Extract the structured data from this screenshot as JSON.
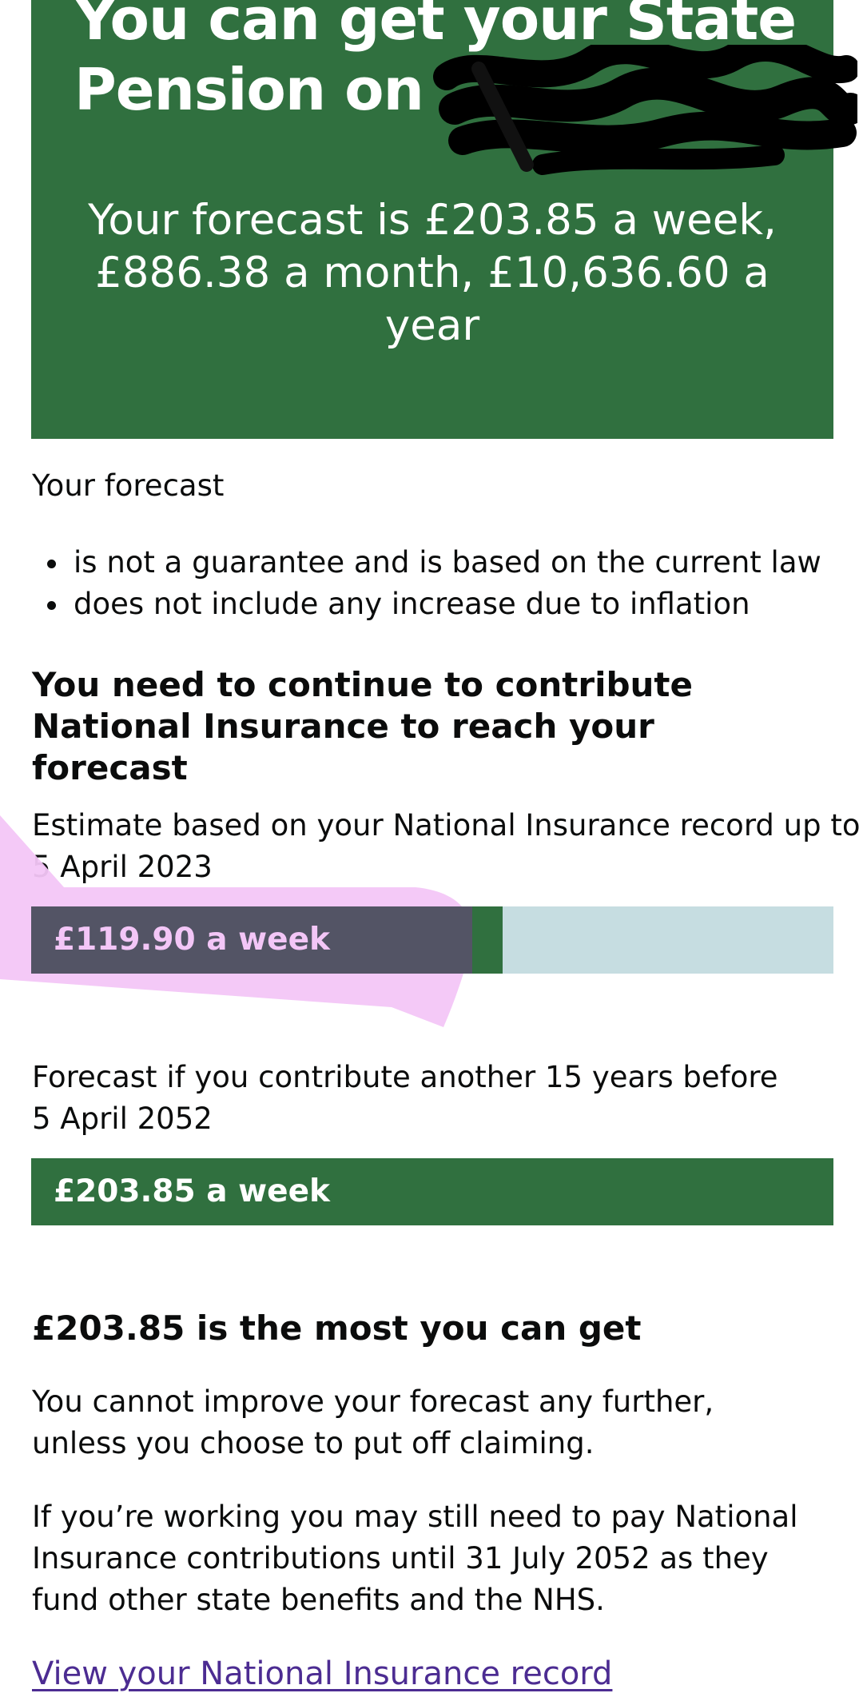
{
  "summary": {
    "title": "You can get your State Pension on",
    "forecast": "Your forecast is £203.85 a week, £886.38 a month, £10,636.60 a year"
  },
  "forecast_notes": {
    "intro": "Your forecast",
    "bullets": [
      "is not a guarantee and is based on the current law",
      "does not include any increase due to inflation"
    ]
  },
  "contribute_heading": "You need to continue to contribute National Insurance to reach your forecast",
  "estimate": {
    "label_line1": "Estimate based on your National Insurance record up to",
    "label_line2": "5 April 2023",
    "bar_label": "£119.90 a week",
    "value_per_week": 119.9,
    "fraction_of_max": 0.588
  },
  "projected": {
    "label_line1": "Forecast if you contribute another 15 years before",
    "label_line2": "5 April 2052",
    "bar_label": "£203.85 a week",
    "value_per_week": 203.85,
    "fraction_of_max": 1.0
  },
  "max": {
    "heading": "£203.85 is the most you can get",
    "para1": "You cannot improve your forecast any further, unless you choose to put off claiming.",
    "para2": "If you’re working you may still need to pay National Insurance contributions until 31 July 2052 as they fund other state benefits and the NHS."
  },
  "links": {
    "ni_record": "View your National Insurance record"
  },
  "colors": {
    "panel_green": "#30703f",
    "bar_background": "#c6dde1",
    "link_purple": "#4c2c92",
    "annotation_pink": "#f3c6f7",
    "annotation_grey": "#535465"
  }
}
